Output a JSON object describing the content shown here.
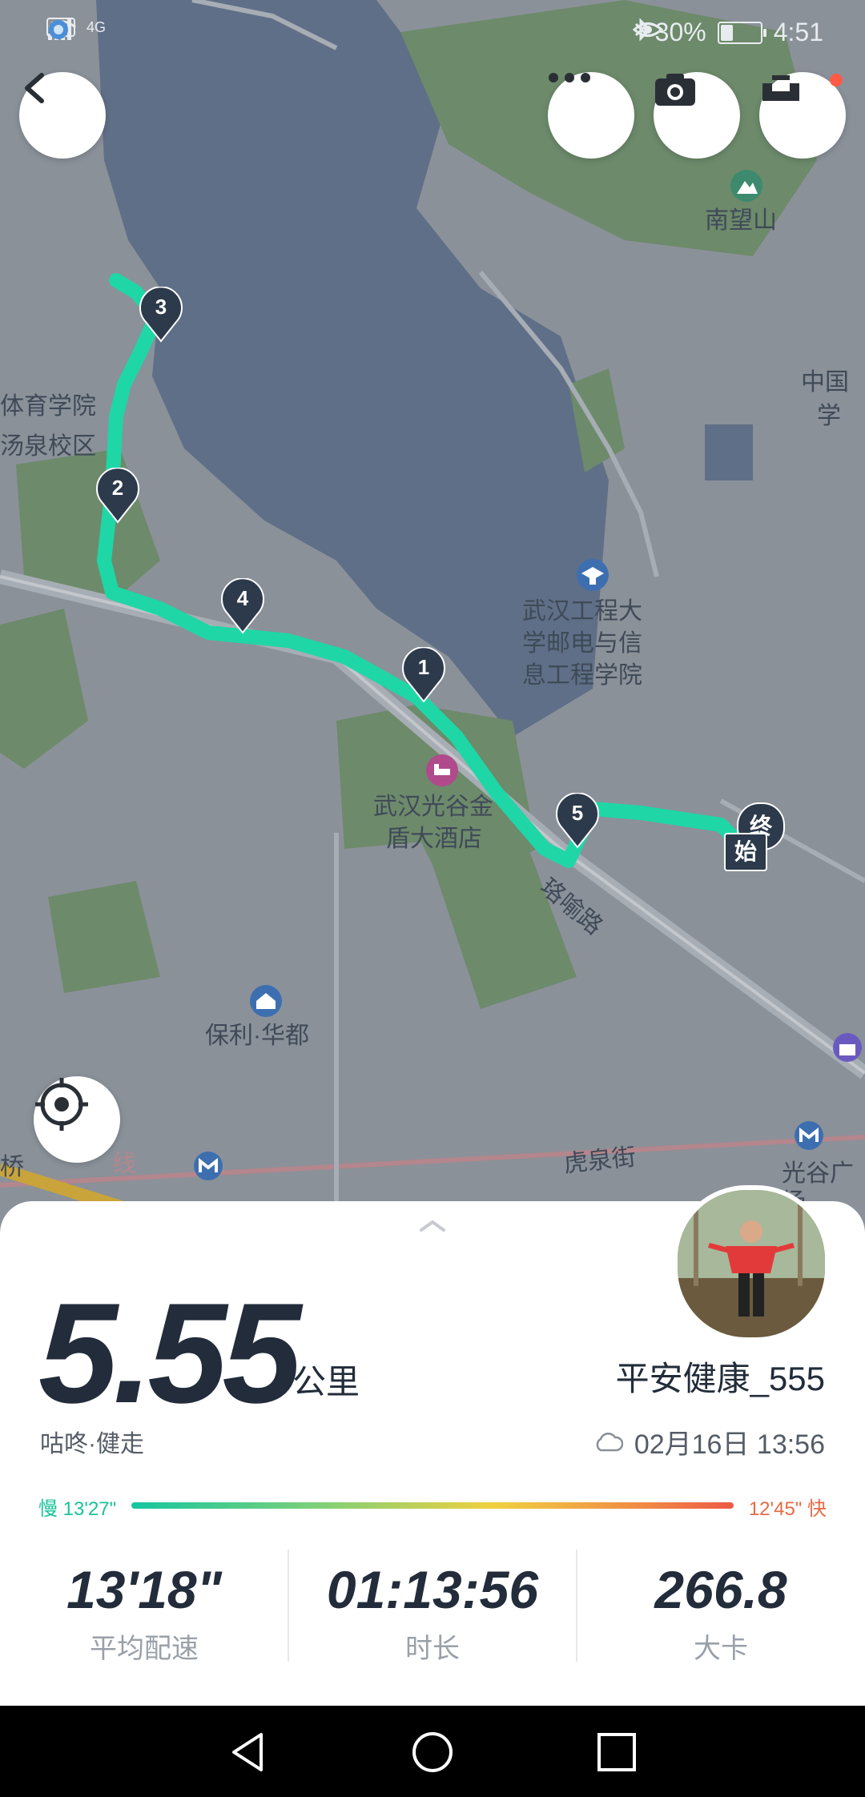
{
  "status_bar": {
    "hd": "HD",
    "network": "4G",
    "battery": "30%",
    "battery_fraction": 0.3,
    "time": "4:51"
  },
  "map": {
    "labels": [
      {
        "id": "nanwangshan",
        "text": "南望山"
      },
      {
        "id": "tiyu1",
        "text": "体育学院"
      },
      {
        "id": "tiyu2",
        "text": "汤泉校区"
      },
      {
        "id": "zhongguo1",
        "text": "中国"
      },
      {
        "id": "zhongguo2",
        "text": "学"
      },
      {
        "id": "wuhan_gc1",
        "text": "武汉工程大"
      },
      {
        "id": "wuhan_gc2",
        "text": "学邮电与信"
      },
      {
        "id": "wuhan_gc3",
        "text": "息工程学院"
      },
      {
        "id": "hotel1",
        "text": "武汉光谷金"
      },
      {
        "id": "hotel2",
        "text": "盾大酒店"
      },
      {
        "id": "luoyu",
        "text": "珞喻路"
      },
      {
        "id": "poly",
        "text": "保利·华都"
      },
      {
        "id": "huquan",
        "text": "虎泉街"
      },
      {
        "id": "guanggu",
        "text": "光谷广场"
      },
      {
        "id": "bridge",
        "text": "桥"
      },
      {
        "id": "xian",
        "text": "线"
      }
    ],
    "markers": [
      "1",
      "2",
      "3",
      "4",
      "5"
    ],
    "end_label": "终",
    "start_label": "始"
  },
  "summary": {
    "distance": "5.55",
    "unit": "公里",
    "activity": "咕咚·健走",
    "username": "平安健康_555",
    "date": "02月16日 13:56",
    "pace_slow": "慢 13'27\"",
    "pace_fast": "12'45\" 快",
    "stats": [
      {
        "value": "13'18\"",
        "label": "平均配速"
      },
      {
        "value": "01:13:56",
        "label": "时长"
      },
      {
        "value": "266.8",
        "label": "大卡"
      }
    ]
  },
  "colors": {
    "route": "#1fd6a6",
    "marker": "#2c3a4b",
    "text_dark": "#222c3a"
  }
}
